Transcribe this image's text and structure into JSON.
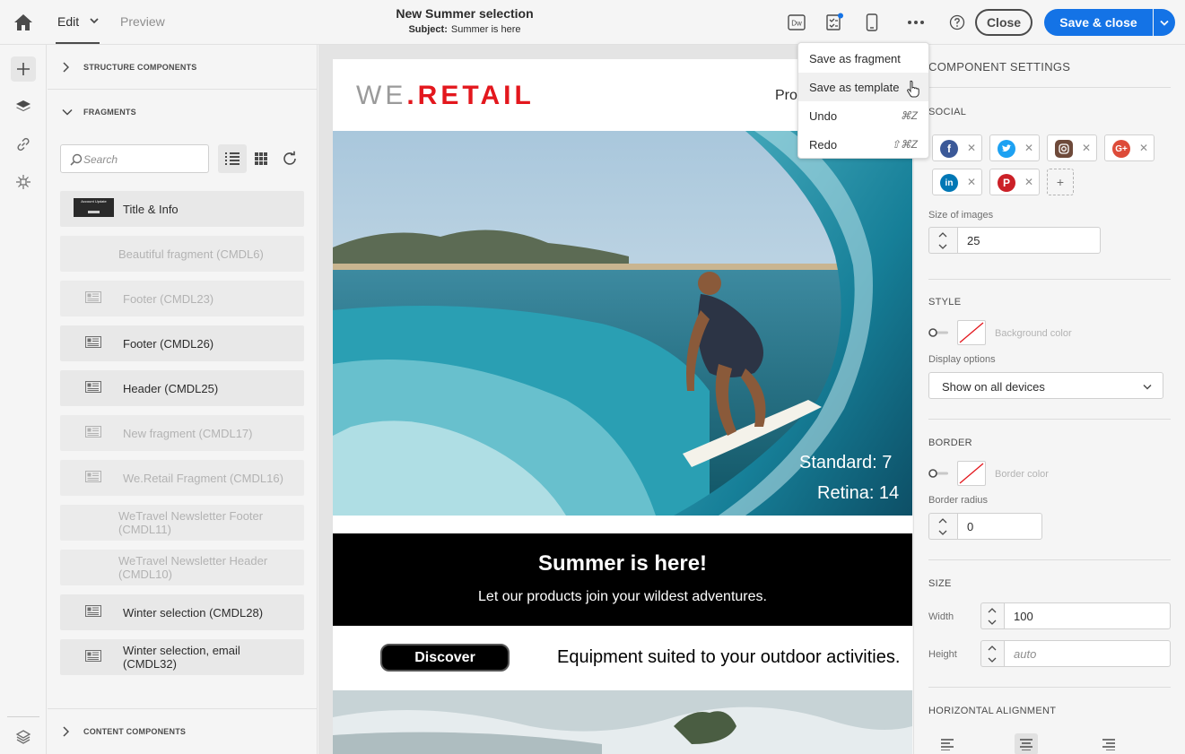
{
  "topbar": {
    "tabs": [
      {
        "label": "Edit"
      },
      {
        "label": "Preview"
      }
    ],
    "title": "New Summer selection",
    "subject_label": "Subject:",
    "subject_value": "Summer is here",
    "close_label": "Close",
    "save_close_label": "Save & close",
    "dw_label": "Dw"
  },
  "left_panel": {
    "structure_label": "STRUCTURE COMPONENTS",
    "fragments_label": "FRAGMENTS",
    "content_label": "CONTENT COMPONENTS",
    "search_placeholder": "Search",
    "fragments": [
      {
        "label": "Title & Info",
        "enabled": true,
        "thumb_text": "Account Update"
      },
      {
        "label": "Beautiful fragment (CMDL6)",
        "enabled": false
      },
      {
        "label": "Footer (CMDL23)",
        "enabled": false
      },
      {
        "label": "Footer (CMDL26)",
        "enabled": true
      },
      {
        "label": "Header (CMDL25)",
        "enabled": true
      },
      {
        "label": "New fragment (CMDL17)",
        "enabled": false
      },
      {
        "label": "We.Retail Fragment (CMDL16)",
        "enabled": false
      },
      {
        "label": "WeTravel Newsletter Footer (CMDL11)",
        "enabled": false
      },
      {
        "label": "WeTravel Newsletter Header (CMDL10)",
        "enabled": false
      },
      {
        "label": "Winter selection (CMDL28)",
        "enabled": true
      },
      {
        "label": "Winter selection, email (CMDL32)",
        "enabled": true
      }
    ]
  },
  "email": {
    "logo_we": "WE",
    "logo_dot": ".",
    "logo_retail": "RETAIL",
    "header_partial": "Pro",
    "overlay_standard": "Standard: 7",
    "overlay_retina": "Retina: 14",
    "headline": "Summer is here!",
    "subline": "Let our products join your wildest adventures.",
    "discover_label": "Discover",
    "equipment_text": "Equipment suited to your outdoor activities."
  },
  "right_panel": {
    "title": "COMPONENT SETTINGS",
    "social_label": "SOCIAL",
    "social_networks": [
      "facebook",
      "twitter",
      "instagram",
      "google-plus",
      "linkedin",
      "pinterest"
    ],
    "size_of_images_label": "Size of images",
    "size_of_images_value": "25",
    "style_label": "STYLE",
    "background_color_label": "Background color",
    "display_options_label": "Display options",
    "display_options_value": "Show on all devices",
    "border_label": "BORDER",
    "border_color_label": "Border color",
    "border_radius_label": "Border radius",
    "border_radius_value": "0",
    "size_label": "SIZE",
    "width_label": "Width",
    "width_value": "100",
    "height_label": "Height",
    "height_placeholder": "auto",
    "horizontal_alignment_label": "HORIZONTAL ALIGNMENT"
  },
  "menu": {
    "items": [
      {
        "label": "Save as fragment",
        "shortcut": ""
      },
      {
        "label": "Save as template",
        "shortcut": ""
      },
      {
        "label": "Undo",
        "shortcut": "⌘Z"
      },
      {
        "label": "Redo",
        "shortcut": "⇧⌘Z"
      }
    ]
  },
  "colors": {
    "accent": "#1473e6",
    "brand_red": "#e3171d"
  }
}
